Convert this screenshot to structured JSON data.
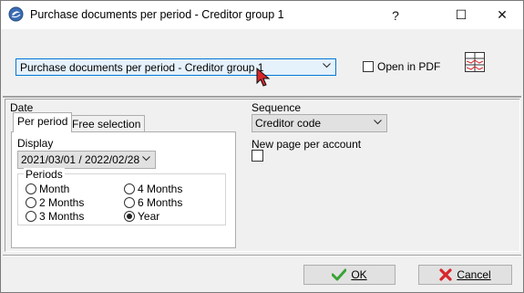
{
  "window": {
    "title": "Purchase documents per period - Creditor group 1",
    "help_glyph": "?",
    "maximize_glyph": "☐",
    "close_glyph": "✕"
  },
  "report": {
    "selected": "Purchase documents per period - Creditor group 1",
    "open_pdf_label": "Open in PDF",
    "open_pdf_checked": false
  },
  "date": {
    "label": "Date",
    "tabs": [
      {
        "label": "Per period",
        "active": true
      },
      {
        "label": "Free selection",
        "active": false
      }
    ],
    "display_label": "Display",
    "display_value": "2021/03/01 / 2022/02/28",
    "periods_label": "Periods",
    "periods": [
      {
        "label": "Month",
        "selected": false
      },
      {
        "label": "2 Months",
        "selected": false
      },
      {
        "label": "3 Months",
        "selected": false
      },
      {
        "label": "4 Months",
        "selected": false
      },
      {
        "label": "6 Months",
        "selected": false
      },
      {
        "label": "Year",
        "selected": true
      }
    ]
  },
  "sequence": {
    "label": "Sequence",
    "value": "Creditor code",
    "new_page_label": "New page per account",
    "new_page_checked": false
  },
  "buttons": {
    "ok_label": "OK",
    "ok_icon": "green-check-icon",
    "cancel_label": "Cancel",
    "cancel_icon": "red-x-icon"
  },
  "colors": {
    "accent_blue": "#0078d7",
    "ok_green": "#3aa335",
    "cancel_red": "#d8262b"
  }
}
